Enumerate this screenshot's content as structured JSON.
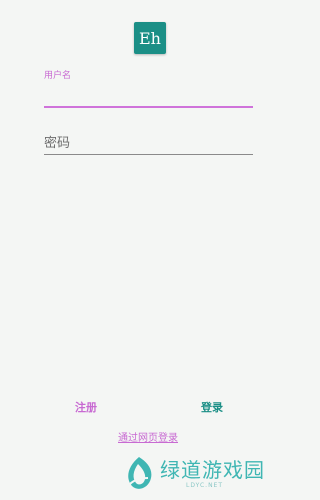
{
  "app": {
    "logo_text": "Eh",
    "brand_color": "#1b8f86",
    "accent_color": "#c86ad2"
  },
  "login_form": {
    "username_label": "用户名",
    "username_value": "",
    "password_placeholder": "密码",
    "password_value": ""
  },
  "actions": {
    "register_label": "注册",
    "login_label": "登录",
    "web_login_label": "通过网页登录"
  },
  "watermark": {
    "text": "绿道游戏园",
    "subtext": "LDYC.NET",
    "icon": "leaf-logo-icon"
  }
}
